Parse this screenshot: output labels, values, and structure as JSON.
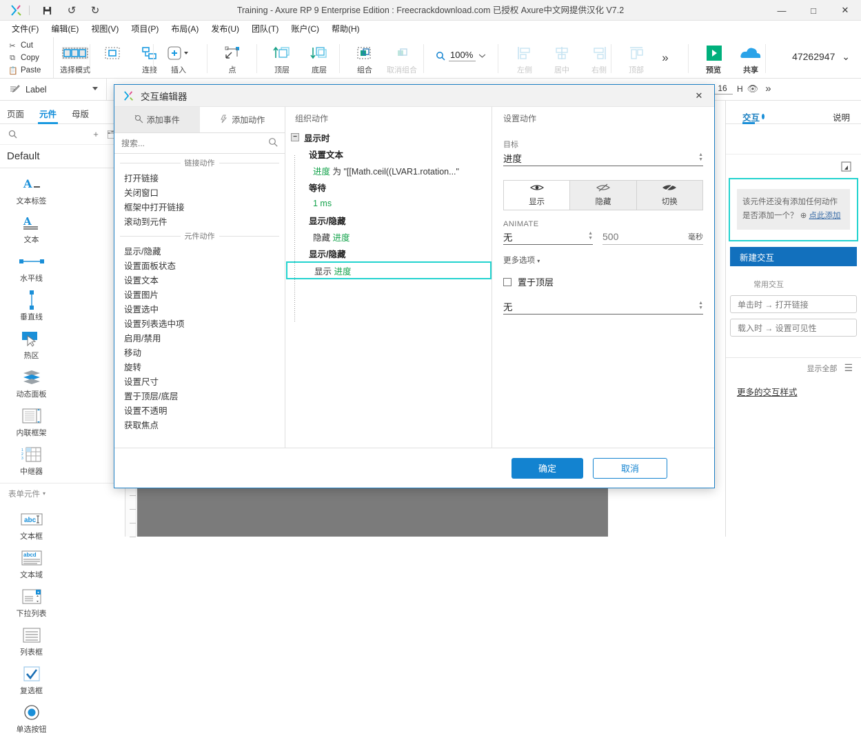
{
  "window": {
    "title": "Training - Axure RP 9 Enterprise Edition : Freecrackdownload.com 已授权    Axure中文网提供汉化 V7.2",
    "minimize": "—",
    "maximize": "□",
    "close": "✕",
    "save_icon": "save-icon",
    "undo_icon": "undo-icon",
    "redo_icon": "redo-icon"
  },
  "menu": {
    "items": [
      "文件(F)",
      "编辑(E)",
      "视图(V)",
      "项目(P)",
      "布局(A)",
      "发布(U)",
      "团队(T)",
      "账户(C)",
      "帮助(H)"
    ]
  },
  "toolbar": {
    "clipboard": [
      {
        "label": "Cut",
        "icon": "scissors-icon"
      },
      {
        "label": "Copy",
        "icon": "copy-icon"
      },
      {
        "label": "Paste",
        "icon": "paste-icon"
      }
    ],
    "buttons": [
      {
        "label": "选择模式",
        "icon": "select-mode-icon",
        "dim": false
      },
      {
        "label": "",
        "icon": "marquee-icon",
        "dim": false
      },
      {
        "label": "连接",
        "icon": "connect-icon",
        "dim": false
      },
      {
        "label": "插入",
        "icon": "insert-icon",
        "dim": false
      },
      {
        "label": "点",
        "icon": "point-icon",
        "dim": false
      },
      {
        "label": "顶层",
        "icon": "bring-front-icon",
        "dim": false
      },
      {
        "label": "底层",
        "icon": "send-back-icon",
        "dim": false
      },
      {
        "label": "组合",
        "icon": "group-icon",
        "dim": false
      },
      {
        "label": "取消组合",
        "icon": "ungroup-icon",
        "dim": true
      },
      {
        "label": "左侧",
        "icon": "align-left-icon",
        "dim": true
      },
      {
        "label": "居中",
        "icon": "align-center-icon",
        "dim": true
      },
      {
        "label": "右侧",
        "icon": "align-right-icon",
        "dim": true
      },
      {
        "label": "顶部",
        "icon": "align-top-icon",
        "dim": true
      }
    ],
    "zoom": "100%",
    "overflow": "»",
    "preview": "预览",
    "share": "共享",
    "account": "47262947"
  },
  "labelbar": {
    "label": "Label",
    "w_value": "16",
    "h_label": "H",
    "eye_icon": "eye-icon",
    "more": "»"
  },
  "left_panel": {
    "tabs": [
      {
        "label": "页面",
        "active": false
      },
      {
        "label": "元件",
        "active": true
      },
      {
        "label": "母版",
        "active": false
      }
    ],
    "search_placeholder": "",
    "library": "Default",
    "widgets": [
      {
        "label": "文本标签",
        "icon": "text-label-icon"
      },
      {
        "label": "文本",
        "icon": "text-paragraph-icon"
      },
      {
        "label": "水平线",
        "icon": "horizontal-line-icon"
      },
      {
        "label": "垂直线",
        "icon": "vertical-line-icon"
      },
      {
        "label": "热区",
        "icon": "hotspot-icon"
      },
      {
        "label": "动态面板",
        "icon": "dynamic-panel-icon"
      },
      {
        "label": "内联框架",
        "icon": "inline-frame-icon"
      },
      {
        "label": "中继器",
        "icon": "repeater-icon"
      }
    ],
    "form_section": "表单元件",
    "form_widgets": [
      {
        "label": "文本框",
        "icon": "textbox-icon"
      },
      {
        "label": "文本域",
        "icon": "textarea-icon"
      },
      {
        "label": "下拉列表",
        "icon": "dropdown-icon"
      },
      {
        "label": "列表框",
        "icon": "listbox-icon"
      },
      {
        "label": "复选框",
        "icon": "checkbox-icon"
      },
      {
        "label": "单选按钮",
        "icon": "radio-icon"
      }
    ]
  },
  "right_panel": {
    "tabs": [
      {
        "label": "交互",
        "active": true
      },
      {
        "label": "说明",
        "active": false
      }
    ],
    "note_line1": "该元件还没有添加任何动作",
    "note_line2_pre": "是否添加一个？",
    "note_link": "点此添加",
    "new_interaction": "新建交互",
    "common_title": "常用交互",
    "suggestions": [
      "单击时 → 打开链接",
      "载入时 → 设置可见性"
    ],
    "show_all": "显示全部",
    "style_link": "更多的交互样式"
  },
  "dialog": {
    "title": "交互编辑器",
    "close": "✕",
    "tabs": [
      {
        "label": "添加事件",
        "icon": "event-icon",
        "active": true
      },
      {
        "label": "添加动作",
        "icon": "action-icon",
        "active": false
      }
    ],
    "search_placeholder": "搜索...",
    "groups": [
      {
        "title": "链接动作",
        "items": [
          "打开链接",
          "关闭窗口",
          "框架中打开链接",
          "滚动到元件"
        ]
      },
      {
        "title": "元件动作",
        "items": [
          "显示/隐藏",
          "设置面板状态",
          "设置文本",
          "设置图片",
          "设置选中",
          "设置列表选中项",
          "启用/禁用",
          "移动",
          "旋转",
          "设置尺寸",
          "置于顶层/底层",
          "设置不透明",
          "获取焦点"
        ]
      }
    ],
    "organize_title": "组织动作",
    "tree": [
      {
        "level": 0,
        "text": "显示时",
        "toggle": "−",
        "selected": false
      },
      {
        "level": 1,
        "text": "设置文本",
        "selected": false
      },
      {
        "level": 2,
        "text": "进度",
        "suffix": " 为 \"[[Math.ceil((LVAR1.rotation...\"",
        "green_first": true,
        "selected": false
      },
      {
        "level": 1,
        "text": "等待",
        "selected": false
      },
      {
        "level": 2,
        "text": "1 ms",
        "all_green": true,
        "selected": false
      },
      {
        "level": 1,
        "text": "显示/隐藏",
        "selected": false
      },
      {
        "level": 2,
        "text": "隐藏 ",
        "green_tail": "进度",
        "selected": false
      },
      {
        "level": 1,
        "text": "显示/隐藏",
        "selected": false
      },
      {
        "level": 2,
        "text": "显示 ",
        "green_tail": "进度",
        "selected": true
      }
    ],
    "settings_title": "设置动作",
    "target_label": "目标",
    "target_value": "进度",
    "visibility": [
      {
        "label": "显示",
        "icon": "eye-show-icon",
        "active": true
      },
      {
        "label": "隐藏",
        "icon": "eye-hide-icon",
        "active": false
      },
      {
        "label": "切换",
        "icon": "eye-toggle-icon",
        "active": false
      }
    ],
    "animate_label": "ANIMATE",
    "animate_value": "无",
    "duration_placeholder": "500",
    "duration_unit": "毫秒",
    "more_options": "更多选项",
    "bring_front_label": "置于顶层",
    "bring_front_checked": false,
    "last_select": "无",
    "ok": "确定",
    "cancel": "取消"
  },
  "colors": {
    "accent_blue": "#1383d0",
    "green": "#12a24a",
    "cyan": "#22d3cf",
    "titlebar_bg": "#f2f2f2"
  }
}
